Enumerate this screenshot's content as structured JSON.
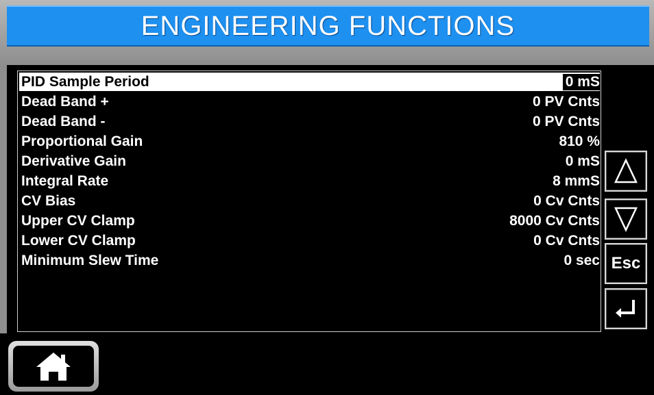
{
  "header": {
    "title": "ENGINEERING FUNCTIONS"
  },
  "settings": {
    "rows": [
      {
        "label": "PID Sample Period",
        "value": "0  mS"
      },
      {
        "label": "Dead Band +",
        "value": "0  PV Cnts"
      },
      {
        "label": "Dead Band -",
        "value": "0  PV Cnts"
      },
      {
        "label": "Proportional Gain",
        "value": "810  %"
      },
      {
        "label": "Derivative Gain",
        "value": "0  mS"
      },
      {
        "label": "Integral Rate",
        "value": "8  mmS"
      },
      {
        "label": "CV Bias",
        "value": "0  Cv Cnts"
      },
      {
        "label": "Upper CV Clamp",
        "value": "8000  Cv Cnts"
      },
      {
        "label": "Lower CV Clamp",
        "value": "0  Cv Cnts"
      },
      {
        "label": "Minimum Slew Time",
        "value": "0  sec"
      }
    ],
    "selected_index": 0
  },
  "nav": {
    "up_icon": "up-triangle-icon",
    "down_icon": "down-triangle-icon",
    "esc_label": "Esc",
    "enter_icon": "enter-return-icon",
    "home_icon": "home-icon"
  },
  "colors": {
    "title_bar": "#1e90f0",
    "background": "#000000",
    "text": "#ffffff",
    "selection": "#ffffff"
  }
}
